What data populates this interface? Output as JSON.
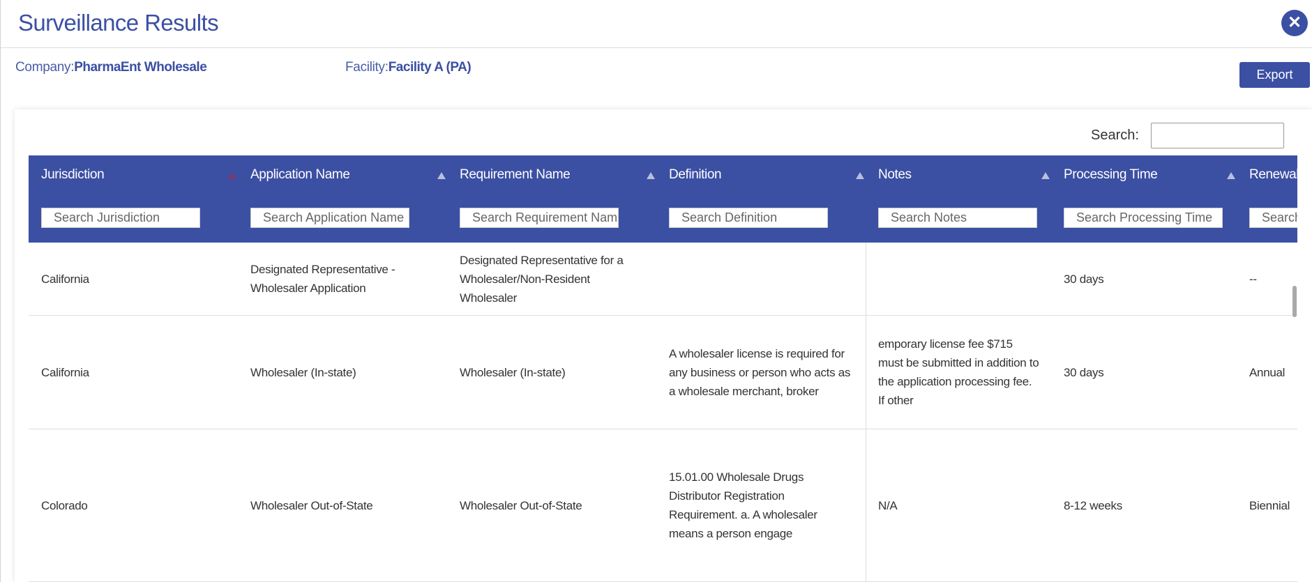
{
  "header": {
    "title": "Surveillance Results",
    "close_icon": "close-icon"
  },
  "info": {
    "company_label": "Company:",
    "company_value": "PharmaEnt Wholesale",
    "facility_label": "Facility:",
    "facility_value": "Facility A (PA)"
  },
  "toolbar": {
    "export_label": "Export",
    "search_label": "Search:"
  },
  "table": {
    "columns": [
      {
        "label": "Jurisdiction",
        "placeholder": "Search Jurisdiction"
      },
      {
        "label": "Application Name",
        "placeholder": "Search Application Name"
      },
      {
        "label": "Requirement Name",
        "placeholder": "Search Requirement Name"
      },
      {
        "label": "Definition",
        "placeholder": "Search Definition"
      },
      {
        "label": "Notes",
        "placeholder": "Search Notes"
      },
      {
        "label": "Processing Time",
        "placeholder": "Search Processing Time"
      },
      {
        "label": "Renewal",
        "placeholder": "Search"
      }
    ],
    "rows": [
      {
        "jurisdiction": "California",
        "application_name": "Designated Representative - Wholesaler Application",
        "requirement_name": "Designated Representative for a Wholesaler/Non-Resident Wholesaler",
        "definition": "",
        "notes": "",
        "processing_time": "30 days",
        "renewal": "--"
      },
      {
        "jurisdiction": "California",
        "application_name": "Wholesaler (In-state)",
        "requirement_name": "Wholesaler (In-state)",
        "definition": "A wholesaler license is required for any business or person who acts as a wholesale merchant, broker",
        "notes": "emporary license fee $715 must be submitted in addition to the application processing fee. If other",
        "processing_time": "30 days",
        "renewal": "Annual"
      },
      {
        "jurisdiction": "Colorado",
        "application_name": "Wholesaler Out-of-State",
        "requirement_name": "Wholesaler Out-of-State",
        "definition": "15.01.00 Wholesale Drugs Distributor Registration Requirement. a. A wholesaler means a person engage",
        "notes": "N/A",
        "processing_time": "8-12 weeks",
        "renewal": "Biennial"
      }
    ]
  },
  "colors": {
    "primary": "#3b4fa3",
    "header_text": "#ffffff",
    "sort_active": "#7a3a6a"
  }
}
